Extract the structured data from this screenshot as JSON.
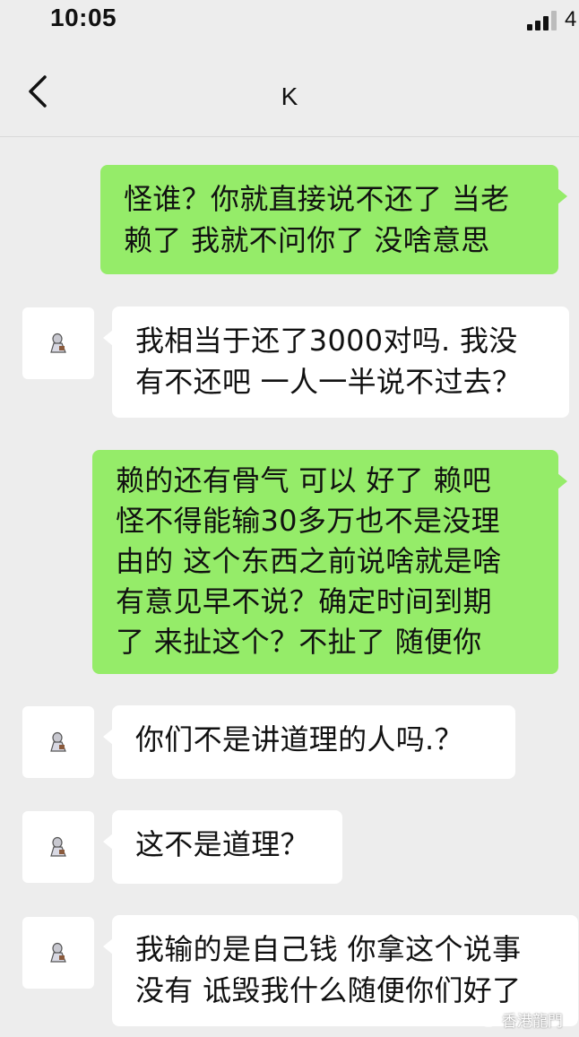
{
  "status_bar": {
    "time": "10:05",
    "extra": "4"
  },
  "header": {
    "title": "K"
  },
  "messages": [
    {
      "side": "out",
      "text": "怪谁？你就直接说不还了 当老\n赖了 我就不问你了 没啥意思"
    },
    {
      "side": "in",
      "text": "我相当于还了3000对吗. 我没\n有不还吧 一人一半说不过去？"
    },
    {
      "side": "out",
      "text": "赖的还有骨气 可以 好了 赖吧\n怪不得能输30多万也不是没理\n由的 这个东西之前说啥就是啥\n有意见早不说？确定时间到期\n了 来扯这个？不扯了 随便你"
    },
    {
      "side": "in",
      "text": "你们不是讲道理的人吗.？"
    },
    {
      "side": "in",
      "text": "这不是道理？"
    },
    {
      "side": "in",
      "text": "我输的是自己钱 你拿这个说事\n没有 诋毁我什么随便你们好了"
    }
  ],
  "watermark": {
    "text": "香港龍門"
  },
  "colors": {
    "background": "#ededed",
    "outgoing_bubble": "#95ec69",
    "incoming_bubble": "#ffffff"
  },
  "icons": {
    "back": "chevron-left-icon",
    "signal": "signal-bars-icon",
    "avatar": "avatar-figure-icon"
  }
}
